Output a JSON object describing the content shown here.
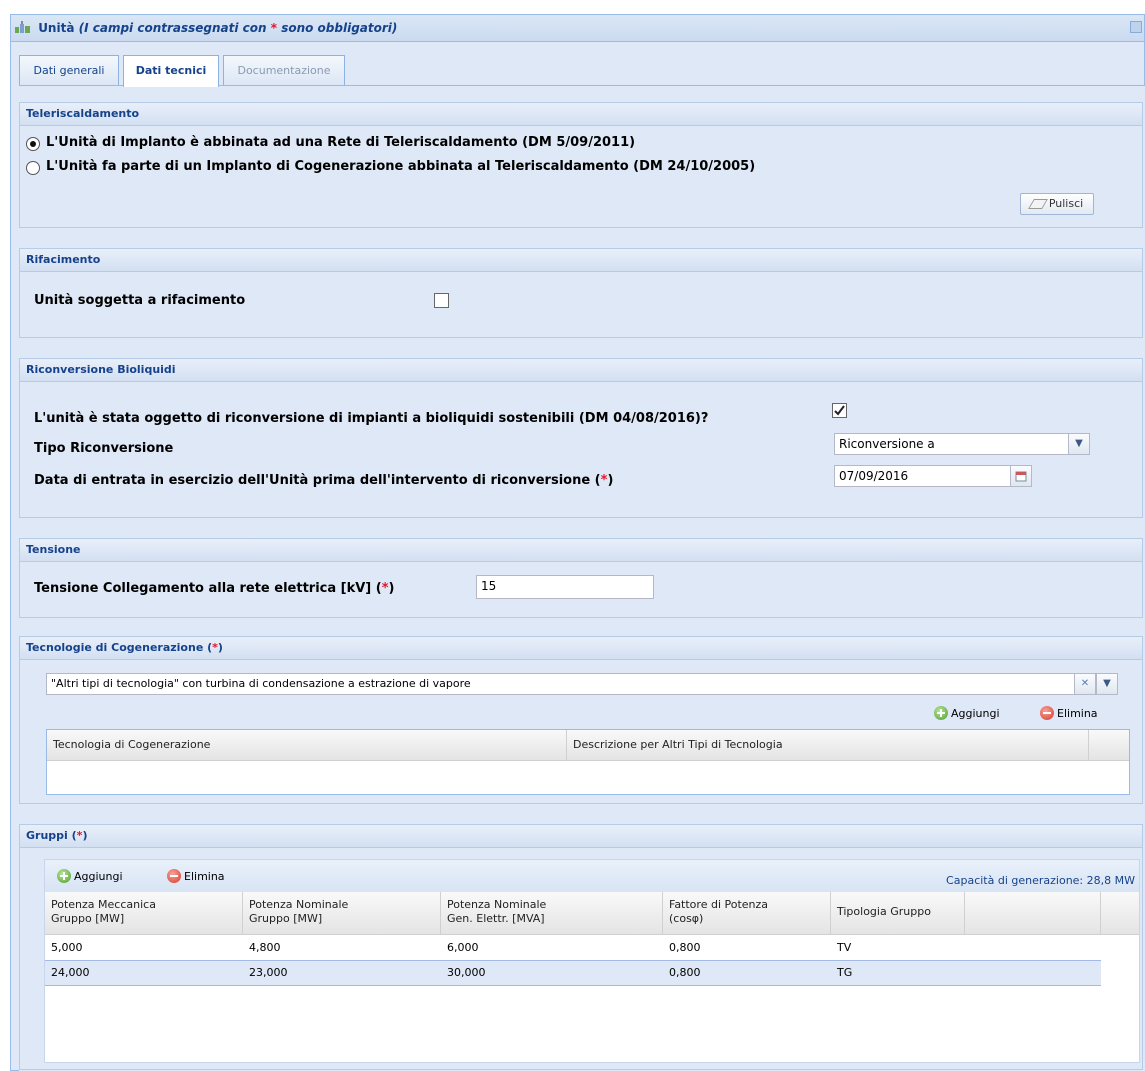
{
  "window": {
    "title_main": "Unità",
    "title_note_before": "(I campi contrassegnati con ",
    "title_note_star": "*",
    "title_note_after": " sono obbligatori)"
  },
  "tabs": [
    {
      "label": "Dati generali"
    },
    {
      "label": "Dati tecnici"
    },
    {
      "label": "Documentazione"
    }
  ],
  "teleriscaldamento": {
    "legend": "Teleriscaldamento",
    "option1": "L'Unità di Implanto è abbinata ad una Rete di Teleriscaldamento (DM 5/09/2011)",
    "option2": "L'Unità fa parte di un Implanto di Cogenerazione abbinata al Teleriscaldamento (DM 24/10/2005)",
    "selected": 1,
    "clear_label": "Pulisci"
  },
  "rifacimento": {
    "legend": "Rifacimento",
    "label": "Unità soggetta a rifacimento",
    "checked": false
  },
  "riconversione": {
    "legend": "Riconversione Bioliquidi",
    "question": "L'unità è stata oggetto di riconversione di impianti a bioliquidi sostenibili (DM 04/08/2016)?",
    "checked": true,
    "tipo_label": "Tipo Riconversione",
    "tipo_value": "Riconversione a",
    "data_label": "Data di entrata in esercizio dell'Unità prima dell'intervento di riconversione (",
    "data_star": "*",
    "data_close": ")",
    "data_value": "07/09/2016"
  },
  "tensione": {
    "legend": "Tensione",
    "label": "Tensione Collegamento alla rete elettrica [kV] (",
    "star": "*",
    "close": ")",
    "value": "15"
  },
  "tecnologie": {
    "legend": "Tecnologie di Cogenerazione (",
    "legend_star": "*",
    "legend_close": ")",
    "combo_value": "\"Altri tipi di tecnologia\" con turbina di condensazione a estrazione di vapore",
    "add_label": "Aggiungi",
    "delete_label": "Elimina",
    "columns": [
      "Tecnologia di Cogenerazione",
      "Descrizione per Altri Tipi di Tecnologia"
    ]
  },
  "gruppi": {
    "legend": "Gruppi (",
    "legend_star": "*",
    "legend_close": ")",
    "add_label": "Aggiungi",
    "delete_label": "Elimina",
    "capacity": "Capacità di generazione: 28,8 MW",
    "columns": [
      [
        "Potenza Meccanica",
        "Gruppo [MW]"
      ],
      [
        "Potenza Nominale",
        "Gruppo [MW]"
      ],
      [
        "Potenza Nominale",
        "Gen. Elettr. [MVA]"
      ],
      [
        "Fattore di Potenza",
        "(cosφ)"
      ],
      [
        "Tipologia Gruppo",
        ""
      ]
    ],
    "rows": [
      [
        "5,000",
        "4,800",
        "6,000",
        "0,800",
        "TV"
      ],
      [
        "24,000",
        "23,000",
        "30,000",
        "0,800",
        "TG"
      ]
    ]
  }
}
